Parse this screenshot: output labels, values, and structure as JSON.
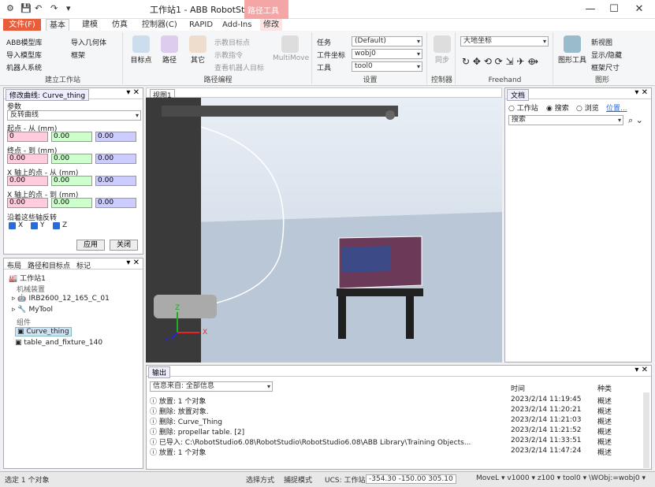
{
  "window": {
    "title": "工作站1 - ABB RobotStudio 6.08",
    "context_tab": "路径工具",
    "minimize": "—",
    "maximize": "☐",
    "close": "✕"
  },
  "tabs": [
    "文件(F)",
    "基本",
    "建模",
    "仿真",
    "控制器(C)",
    "RAPID",
    "Add-Ins",
    "修改"
  ],
  "ribbon": {
    "build_station": {
      "label": "建立工作站",
      "items": [
        "ABB模型库",
        "导入模型库",
        "机器人系统",
        "导入几何体",
        "框架"
      ]
    },
    "path_programming": {
      "label": "路径编程",
      "items": [
        "目标点",
        "路径",
        "其它",
        "示教目标点",
        "示教指令",
        "查看机器人目标",
        "MultiMove"
      ]
    },
    "settings": {
      "label": "设置",
      "task_label": "任务",
      "task_value": "(Default)",
      "wobj_label": "工件坐标",
      "wobj_value": "wobj0",
      "tool_label": "工具",
      "tool_value": "tool0"
    },
    "control": {
      "label": "控制器",
      "sync": "同步"
    },
    "freehand": {
      "label": "Freehand",
      "frame_value": "大地坐标"
    },
    "graphics": {
      "label": "图形",
      "view_tool": "图形工具",
      "new_view": "新视图",
      "show_hide": "显示/隐藏",
      "frame_size": "框架尺寸"
    }
  },
  "curve_panel": {
    "title": "修改曲线: Curve_thing",
    "section": "参数",
    "mode": "反转曲线",
    "start_label": "起点 - 从 (mm)",
    "start_values": [
      "0",
      "0.00",
      "0.00"
    ],
    "end_label": "终点 - 到 (mm)",
    "end_values": [
      "0.00",
      "0.00",
      "0.00"
    ],
    "axis_from_label": "X 轴上的点 - 从 (mm)",
    "axis_from_values": [
      "0.00",
      "0.00",
      "0.00"
    ],
    "axis_to_label": "X 轴上的点 - 到 (mm)",
    "axis_to_values": [
      "0.00",
      "0.00",
      "0.00"
    ],
    "flip_label": "沿着这些轴反转",
    "axes": [
      "X",
      "Y",
      "Z"
    ],
    "apply": "应用",
    "close": "关闭"
  },
  "layout_panel": {
    "tabs": [
      "布局",
      "路径和目标点",
      "标记"
    ],
    "root": "工作站1",
    "section_mech": "机械装置",
    "items": [
      "IRB2600_12_165_C_01",
      "MyTool"
    ],
    "section_parts": "组件",
    "parts": [
      "Curve_thing",
      "table_and_fixture_140"
    ]
  },
  "view": {
    "tab": "视图1",
    "axis_x": "X",
    "axis_y": "Y",
    "axis_z": "Z"
  },
  "docs_panel": {
    "title": "文档",
    "options": [
      "工作站",
      "搜索",
      "浏览"
    ],
    "link": "位置...",
    "search_placeholder": "搜索"
  },
  "output": {
    "title": "输出",
    "filter_label": "信息来自: 全部信息",
    "col_time": "时间",
    "col_type": "种类",
    "rows": [
      {
        "msg": "放置: 1 个对象",
        "time": "2023/2/14 11:19:45",
        "type": "概述"
      },
      {
        "msg": "删除: 放置对象.",
        "time": "2023/2/14 11:20:21",
        "type": "概述"
      },
      {
        "msg": "删除: Curve_Thing",
        "time": "2023/2/14 11:21:03",
        "type": "概述"
      },
      {
        "msg": "删除: propellar table. [2]",
        "time": "2023/2/14 11:21:52",
        "type": "概述"
      },
      {
        "msg": "已导入: C:\\RobotStudio6.08\\RobotStudio\\RobotStudio6.08\\ABB Library\\Training Objects...",
        "time": "2023/2/14 11:33:51",
        "type": "概述"
      },
      {
        "msg": "放置: 1 个对象",
        "time": "2023/2/14 11:47:24",
        "type": "概述"
      }
    ]
  },
  "status": {
    "left": "选定 1 个对象",
    "select_mode": "选择方式",
    "capture_mode": "捕捉模式",
    "ucs": "UCS: 工作站",
    "coords": "-354.30   -150.00   305.10",
    "motion": "MoveL ▾ v1000 ▾ z100 ▾ tool0 ▾ \\WObj:=wobj0 ▾"
  },
  "colors": {
    "file_tab": "#e85d3c",
    "context_tab": "#f4a6a6",
    "accent": "#2a6bd6"
  }
}
